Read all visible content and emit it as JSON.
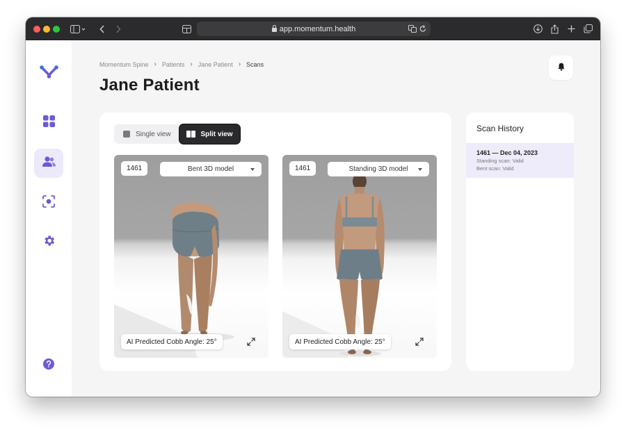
{
  "browser": {
    "url": "app.momentum.health"
  },
  "sidebar": {
    "items": [
      {
        "name": "logo",
        "icon": "momentum-logo-icon"
      },
      {
        "name": "dashboard",
        "icon": "grid-icon"
      },
      {
        "name": "patients",
        "icon": "users-icon",
        "active": true
      },
      {
        "name": "scans",
        "icon": "scan-icon"
      },
      {
        "name": "settings",
        "icon": "gear-icon"
      },
      {
        "name": "help",
        "icon": "help-icon"
      }
    ]
  },
  "breadcrumb": [
    "Momentum Spine",
    "Patients",
    "Jane Patient",
    "Scans"
  ],
  "page_title": "Jane Patient",
  "view_toggle": {
    "single_label": "Single view",
    "split_label": "Split view",
    "selected": "split"
  },
  "panels": [
    {
      "scan_id": "1461",
      "model": "Bent 3D model",
      "cobb": "AI Predicted Cobb Angle: 25°"
    },
    {
      "scan_id": "1461",
      "model": "Standing 3D model",
      "cobb": "AI Predicted Cobb Angle: 25°"
    }
  ],
  "history": {
    "title": "Scan History",
    "items": [
      {
        "title": "1461 — Dec 04, 2023",
        "line1": "Standing scan: Valid",
        "line2": "Bent scan: Valid"
      }
    ]
  },
  "colors": {
    "accent": "#6b5bd6",
    "active_bg": "#ece9fa",
    "dark_button": "#2a2a2c"
  }
}
